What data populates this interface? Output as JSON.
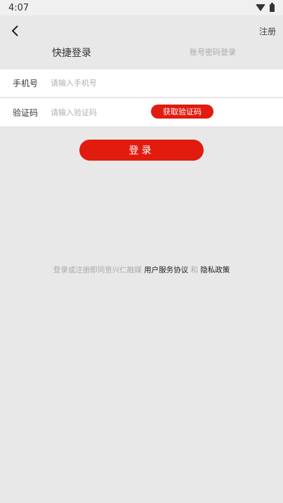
{
  "status_bar": {
    "time": "4:07"
  },
  "nav": {
    "register_label": "注册",
    "tabs": [
      {
        "label": "快捷登录",
        "active": true
      },
      {
        "label": "账号密码登录",
        "active": false
      }
    ]
  },
  "form": {
    "phone_label": "手机号",
    "phone_placeholder": "请输入手机号",
    "code_label": "验证码",
    "code_placeholder": "请输入验证码",
    "get_code_label": "获取验证码"
  },
  "login_label": "登录",
  "agreement": {
    "prefix": "登录或注册即同意兴仁融媒",
    "service_link": "用户服务协议",
    "and": "和",
    "privacy_link": "隐私政策"
  },
  "colors": {
    "accent": "#e21b0f",
    "background": "#e8e8e8"
  }
}
